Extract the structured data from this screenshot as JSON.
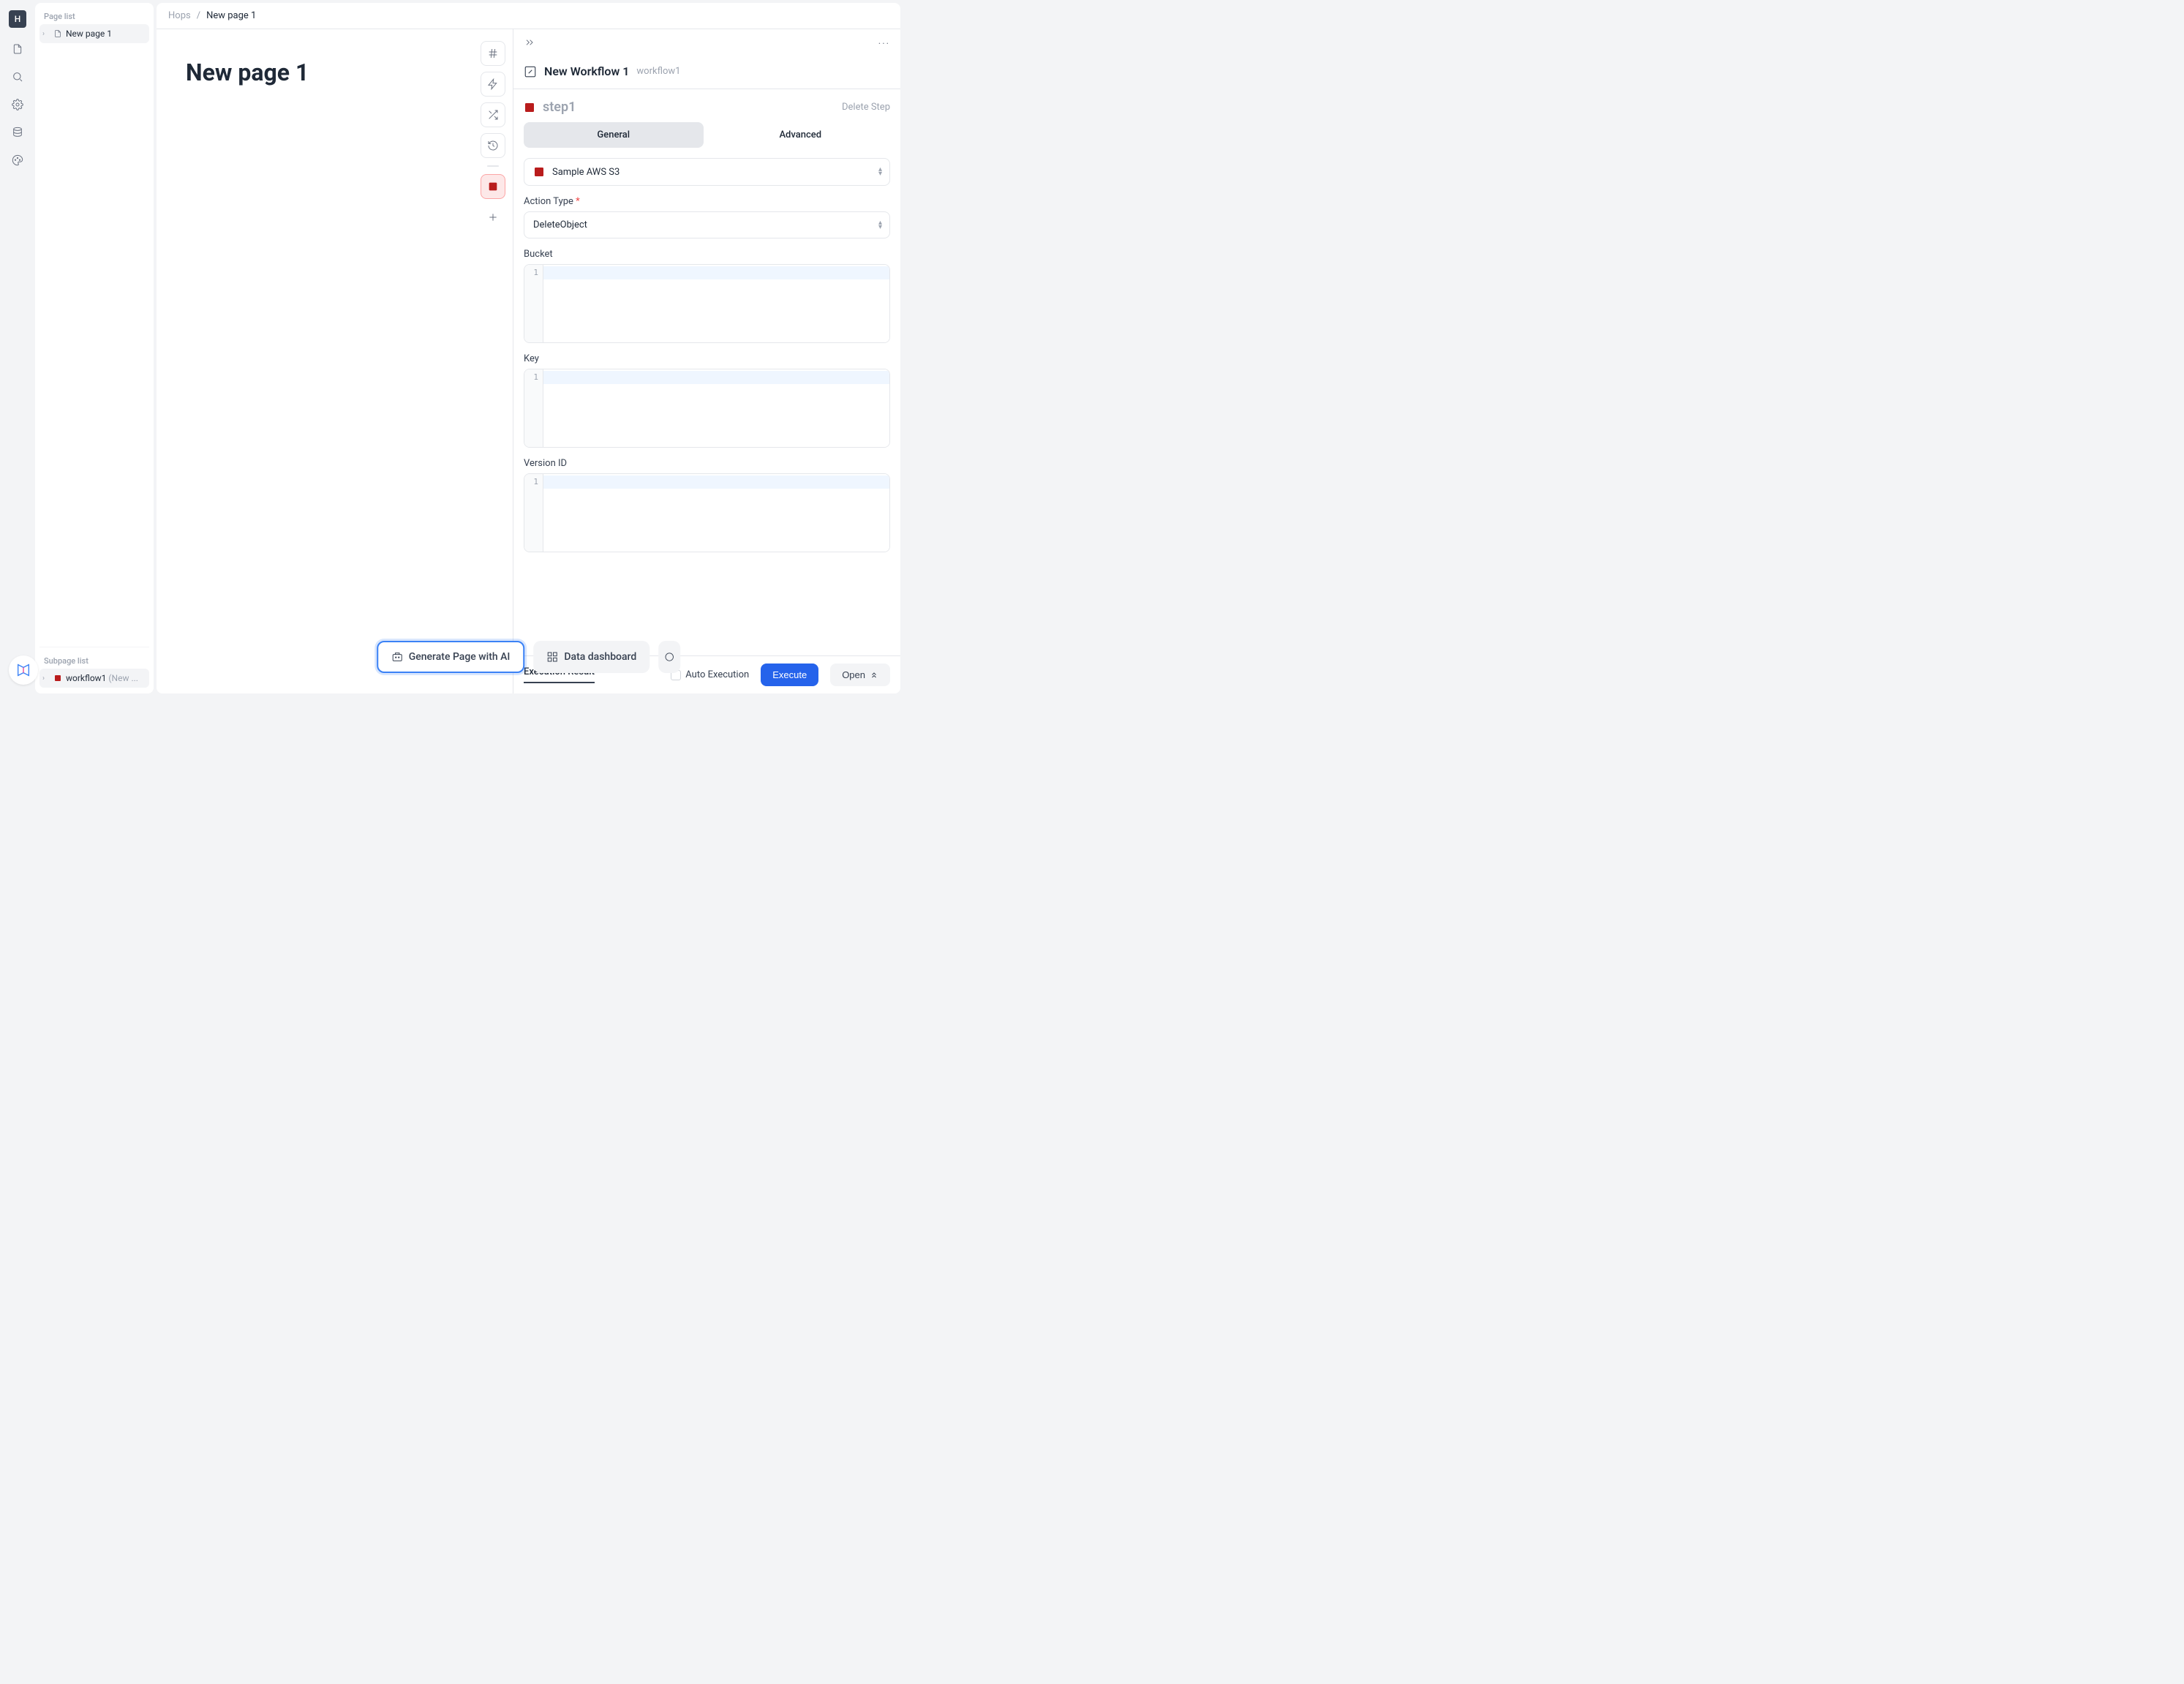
{
  "avatar_letter": "H",
  "page_sidebar": {
    "section_label": "Page list",
    "items": [
      {
        "label": "New page 1"
      }
    ],
    "subpage_label": "Subpage list",
    "subpages": [
      {
        "label": "workflow1",
        "meta": "(New ..."
      }
    ]
  },
  "breadcrumb": {
    "root": "Hops",
    "sep": "/",
    "current": "New page 1"
  },
  "page_title": "New page 1",
  "chips": {
    "ai": "Generate Page with AI",
    "dashboard": "Data dashboard"
  },
  "right_panel": {
    "workflow_title": "New Workflow 1",
    "workflow_sub": "workflow1",
    "step_name": "step1",
    "delete_step": "Delete Step",
    "tabs": {
      "general": "General",
      "advanced": "Advanced"
    },
    "datasource": "Sample AWS S3",
    "fields": {
      "action_type_label": "Action Type",
      "action_type_value": "DeleteObject",
      "bucket_label": "Bucket",
      "key_label": "Key",
      "version_id_label": "Version ID"
    },
    "gutter_line": "1",
    "bottom": {
      "exec_result": "Execution Result",
      "auto_exec": "Auto Execution",
      "execute": "Execute",
      "open": "Open"
    }
  }
}
